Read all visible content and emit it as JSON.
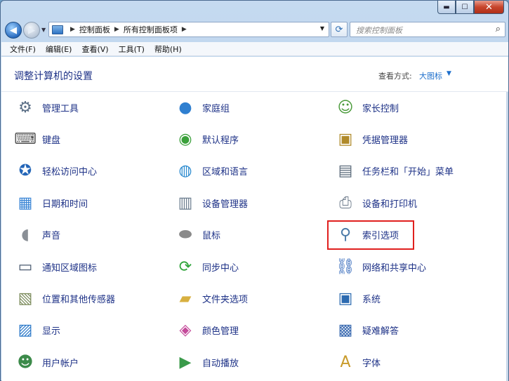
{
  "window": {
    "caption_buttons": {
      "minimize": "▬",
      "maximize": "☐",
      "close": "✕"
    }
  },
  "navbar": {
    "back_glyph": "◀",
    "forward_glyph": "▶",
    "breadcrumb": [
      "控制面板",
      "所有控制面板项"
    ],
    "breadcrumb_sep": "▶",
    "refresh_glyph": "⟳",
    "search_placeholder": "搜索控制面板",
    "search_icon": "⌕"
  },
  "menubar": {
    "items": [
      "文件(F)",
      "编辑(E)",
      "查看(V)",
      "工具(T)",
      "帮助(H)"
    ]
  },
  "content": {
    "title": "调整计算机的设置",
    "view_by_label": "查看方式:",
    "view_by_value": "大图标",
    "view_by_arrow": "▼"
  },
  "items": [
    {
      "label": "管理工具",
      "icon": "admin-tools-icon",
      "glyph": "⚙",
      "color": "#5b6f86"
    },
    {
      "label": "家庭组",
      "icon": "homegroup-icon",
      "glyph": "●",
      "color": "#2f7fd0"
    },
    {
      "label": "家长控制",
      "icon": "parental-controls-icon",
      "glyph": "☺",
      "color": "#4a9a3a"
    },
    {
      "label": "键盘",
      "icon": "keyboard-icon",
      "glyph": "⌨",
      "color": "#555555"
    },
    {
      "label": "默认程序",
      "icon": "default-programs-icon",
      "glyph": "◉",
      "color": "#3aa03a"
    },
    {
      "label": "凭据管理器",
      "icon": "credential-manager-icon",
      "glyph": "▣",
      "color": "#b08a2a"
    },
    {
      "label": "轻松访问中心",
      "icon": "ease-of-access-icon",
      "glyph": "✪",
      "color": "#2466b8"
    },
    {
      "label": "区域和语言",
      "icon": "region-language-icon",
      "glyph": "◍",
      "color": "#2c8bd0"
    },
    {
      "label": "任务栏和「开始」菜单",
      "icon": "taskbar-icon",
      "glyph": "▤",
      "color": "#5a6a7a"
    },
    {
      "label": "日期和时间",
      "icon": "date-time-icon",
      "glyph": "▦",
      "color": "#3b86d6"
    },
    {
      "label": "设备管理器",
      "icon": "device-manager-icon",
      "glyph": "▥",
      "color": "#6b7d8e"
    },
    {
      "label": "设备和打印机",
      "icon": "devices-printers-icon",
      "glyph": "⎙",
      "color": "#6c7a8a"
    },
    {
      "label": "声音",
      "icon": "sound-icon",
      "glyph": "◖",
      "color": "#8a8f96"
    },
    {
      "label": "鼠标",
      "icon": "mouse-icon",
      "glyph": "⬬",
      "color": "#8a8a8a"
    },
    {
      "label": "索引选项",
      "icon": "indexing-options-icon",
      "glyph": "⚲",
      "color": "#4a7aa8"
    },
    {
      "label": "通知区域图标",
      "icon": "notification-area-icon",
      "glyph": "▭",
      "color": "#4a5a70"
    },
    {
      "label": "同步中心",
      "icon": "sync-center-icon",
      "glyph": "⟳",
      "color": "#2fa43a"
    },
    {
      "label": "网络和共享中心",
      "icon": "network-sharing-icon",
      "glyph": "⛓",
      "color": "#2a62b8"
    },
    {
      "label": "位置和其他传感器",
      "icon": "location-sensors-icon",
      "glyph": "▧",
      "color": "#7a8a5a"
    },
    {
      "label": "文件夹选项",
      "icon": "folder-options-icon",
      "glyph": "▰",
      "color": "#d8b040"
    },
    {
      "label": "系统",
      "icon": "system-icon",
      "glyph": "▣",
      "color": "#2c6ab0"
    },
    {
      "label": "显示",
      "icon": "display-icon",
      "glyph": "▨",
      "color": "#2a78c8"
    },
    {
      "label": "颜色管理",
      "icon": "color-management-icon",
      "glyph": "◈",
      "color": "#c44a9a"
    },
    {
      "label": "疑难解答",
      "icon": "troubleshooting-icon",
      "glyph": "▩",
      "color": "#3a6ab0"
    },
    {
      "label": "用户帐户",
      "icon": "user-accounts-icon",
      "glyph": "☻",
      "color": "#3c8a4a"
    },
    {
      "label": "自动播放",
      "icon": "autoplay-icon",
      "glyph": "▶",
      "color": "#3a9a4a"
    },
    {
      "label": "字体",
      "icon": "fonts-icon",
      "glyph": "A",
      "color": "#c89a2a"
    }
  ],
  "highlight": {
    "target": "索引选项",
    "color": "#e0201e"
  }
}
